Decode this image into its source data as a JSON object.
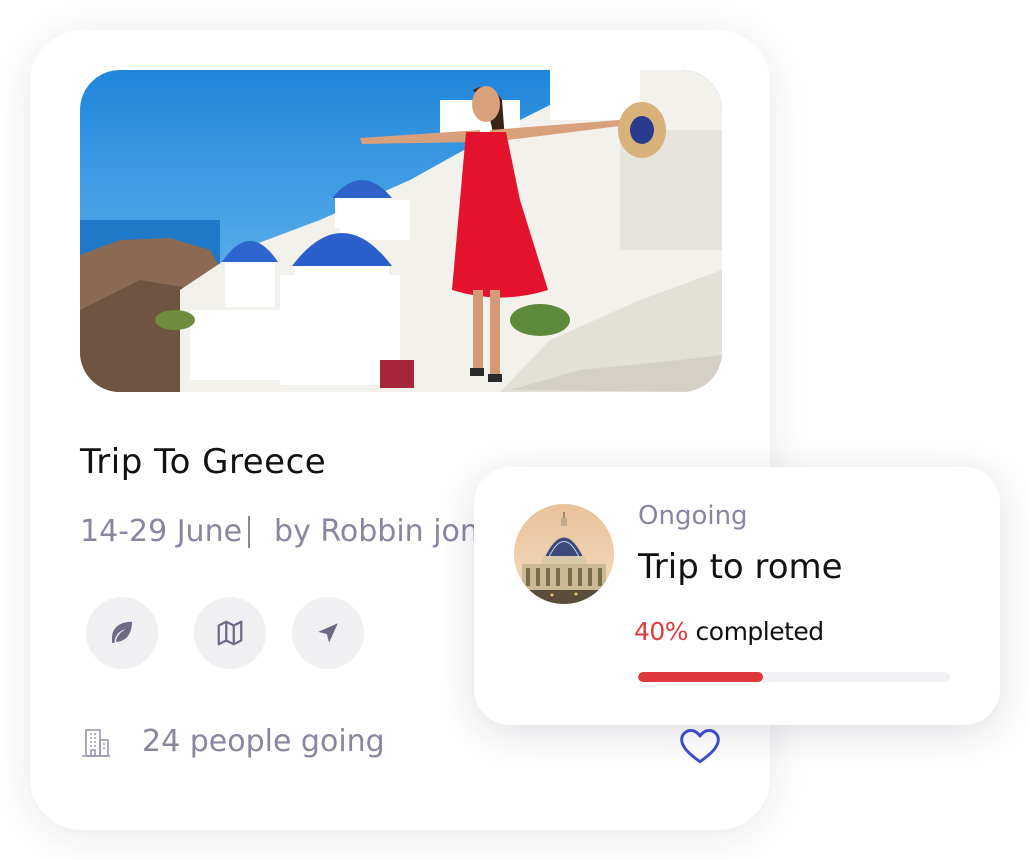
{
  "trip": {
    "title": "Trip To Greece",
    "dates": "14-29 June",
    "organizer": "by Robbin jones",
    "people_count": "24 people going",
    "actions": [
      {
        "icon": "leaf-icon"
      },
      {
        "icon": "map-icon"
      },
      {
        "icon": "send-icon"
      }
    ],
    "favorite_icon": "heart-icon",
    "photo_icon": "greece-santorini-photo"
  },
  "ongoing": {
    "status": "Ongoing",
    "title": "Trip to rome",
    "progress_percent": "40%",
    "progress_suffix": " completed",
    "progress_value": 0.4,
    "avatar_icon": "rome-basilica-photo"
  },
  "colors": {
    "accent_red": "#e0393c",
    "muted_text": "#8a86a0",
    "icon_blue": "#3d4fcf"
  }
}
